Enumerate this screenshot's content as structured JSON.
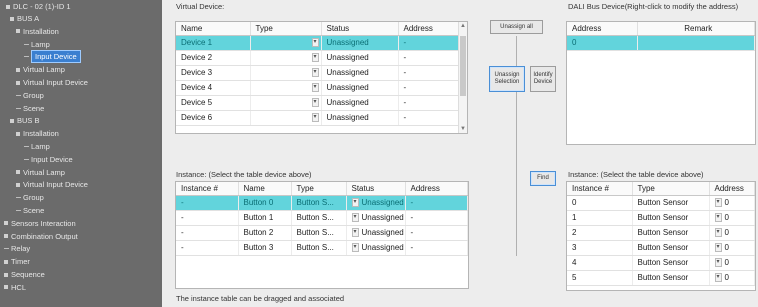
{
  "sidebar": {
    "title": "DLC - 02 (1)-ID 1",
    "items": [
      {
        "label": "BUS A",
        "level": 1,
        "type": "bullet"
      },
      {
        "label": "Installation",
        "level": 2,
        "type": "bullet"
      },
      {
        "label": "Lamp",
        "level": 3,
        "type": "line"
      },
      {
        "label": "Input Device",
        "level": 3,
        "type": "line",
        "selected": true
      },
      {
        "label": "Virtual Lamp",
        "level": 2,
        "type": "bullet"
      },
      {
        "label": "Virtual Input Device",
        "level": 2,
        "type": "bullet"
      },
      {
        "label": "Group",
        "level": 2,
        "type": "line"
      },
      {
        "label": "Scene",
        "level": 2,
        "type": "line"
      },
      {
        "label": "BUS B",
        "level": 1,
        "type": "bullet"
      },
      {
        "label": "Installation",
        "level": 2,
        "type": "bullet"
      },
      {
        "label": "Lamp",
        "level": 3,
        "type": "line"
      },
      {
        "label": "Input Device",
        "level": 3,
        "type": "line"
      },
      {
        "label": "Virtual Lamp",
        "level": 2,
        "type": "bullet"
      },
      {
        "label": "Virtual Input Device",
        "level": 2,
        "type": "bullet"
      },
      {
        "label": "Group",
        "level": 2,
        "type": "line"
      },
      {
        "label": "Scene",
        "level": 2,
        "type": "line"
      },
      {
        "label": "Sensors Interaction",
        "level": 0,
        "type": "bullet"
      },
      {
        "label": "Combination Output",
        "level": 0,
        "type": "bullet"
      },
      {
        "label": "Relay",
        "level": 0,
        "type": "line"
      },
      {
        "label": "Timer",
        "level": 0,
        "type": "bullet"
      },
      {
        "label": "Sequence",
        "level": 0,
        "type": "bullet"
      },
      {
        "label": "HCL",
        "level": 0,
        "type": "bullet"
      }
    ]
  },
  "virtual": {
    "title": "Virtual Device:",
    "headers": [
      "Name",
      "Type",
      "Status",
      "Address"
    ],
    "rows": [
      {
        "name": "Device 1",
        "type": "",
        "status": "Unassigned",
        "address": "-"
      },
      {
        "name": "Device 2",
        "type": "",
        "status": "Unassigned",
        "address": "-"
      },
      {
        "name": "Device 3",
        "type": "",
        "status": "Unassigned",
        "address": "-"
      },
      {
        "name": "Device 4",
        "type": "",
        "status": "Unassigned",
        "address": "-"
      },
      {
        "name": "Device 5",
        "type": "",
        "status": "Unassigned",
        "address": "-"
      },
      {
        "name": "Device 6",
        "type": "",
        "status": "Unassigned",
        "address": "-"
      }
    ]
  },
  "instance_left": {
    "title": "Instance:   (Select the table device above)",
    "headers": [
      "Instance #",
      "Name",
      "Type",
      "Status",
      "Address"
    ],
    "rows": [
      {
        "inst": "-",
        "name": "Button 0",
        "type": "Button S...",
        "status": "Unassigned",
        "address": "-"
      },
      {
        "inst": "-",
        "name": "Button 1",
        "type": "Button S...",
        "status": "Unassigned",
        "address": "-"
      },
      {
        "inst": "-",
        "name": "Button 2",
        "type": "Button S...",
        "status": "Unassigned",
        "address": "-"
      },
      {
        "inst": "-",
        "name": "Button 3",
        "type": "Button S...",
        "status": "Unassigned",
        "address": "-"
      }
    ]
  },
  "buttons": {
    "unassign_all": "Unassign all",
    "unassign_selection": "Unassign Selection",
    "identify_device": "Identify Device",
    "find": "Find"
  },
  "dali": {
    "title": "DALI Bus Device(Right-click to modify the address)",
    "headers": [
      "Address",
      "Remark"
    ],
    "rows": [
      {
        "address": "0",
        "remark": ""
      }
    ]
  },
  "instance_right": {
    "title": "Instance:   (Select the table device above)",
    "headers": [
      "Instance #",
      "Type",
      "Address"
    ],
    "rows": [
      {
        "inst": "0",
        "type": "Button Sensor",
        "address": "0"
      },
      {
        "inst": "1",
        "type": "Button Sensor",
        "address": "0"
      },
      {
        "inst": "2",
        "type": "Button Sensor",
        "address": "0"
      },
      {
        "inst": "3",
        "type": "Button Sensor",
        "address": "0"
      },
      {
        "inst": "4",
        "type": "Button Sensor",
        "address": "0"
      },
      {
        "inst": "5",
        "type": "Button Sensor",
        "address": "0"
      }
    ]
  },
  "footer": "The instance table can be dragged and associated",
  "colors": {
    "selected_row": "#62d4dc",
    "sidebar_bg": "#6b6b6b",
    "tree_selected": "#3a7fd0"
  }
}
